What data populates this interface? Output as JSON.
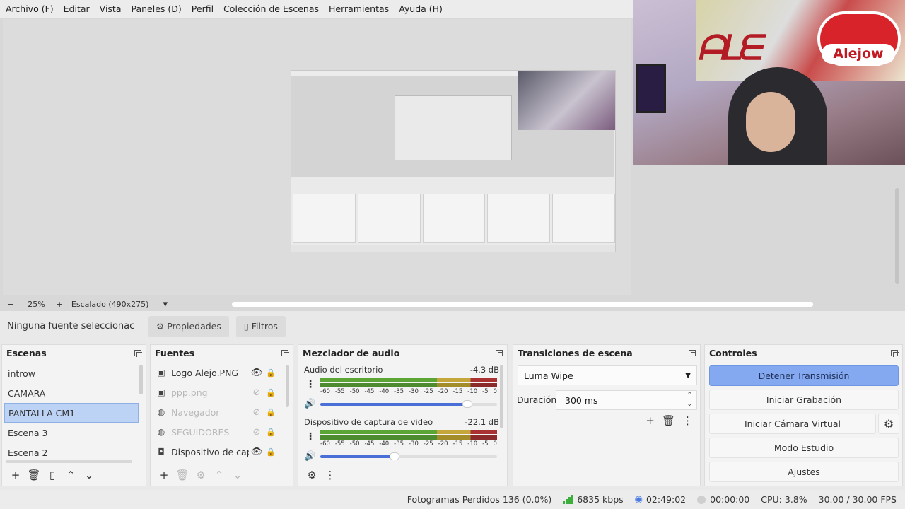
{
  "menu": [
    "Archivo (F)",
    "Editar",
    "Vista",
    "Paneles (D)",
    "Perfil",
    "Colección de Escenas",
    "Herramientas",
    "Ayuda (H)"
  ],
  "webcam": {
    "badge": "Alejow"
  },
  "zoom": {
    "minus": "−",
    "level": "25%",
    "plus": "+",
    "scaling": "Escalado (490x275)",
    "dropdown": "▾"
  },
  "source_toolbar": {
    "no_source": "Ninguna fuente seleccionac",
    "properties": "Propiedades",
    "filters": "Filtros"
  },
  "scenes": {
    "title": "Escenas",
    "items": [
      "introw",
      "CAMARA",
      "PANTALLA CM1",
      "Escena 3",
      "Escena 2"
    ],
    "selected": "PANTALLA CM1"
  },
  "sources": {
    "title": "Fuentes",
    "items": [
      {
        "name": "Logo Alejo.PNG",
        "icon": "image-icon",
        "visible": true,
        "locked": false
      },
      {
        "name": "ppp.png",
        "icon": "image-icon",
        "visible": false,
        "locked": false
      },
      {
        "name": "Navegador",
        "icon": "globe-icon",
        "visible": false,
        "locked": true
      },
      {
        "name": "SEGUIDORES",
        "icon": "globe-icon",
        "visible": false,
        "locked": false
      },
      {
        "name": "Dispositivo de captu",
        "icon": "camera-icon",
        "visible": true,
        "locked": false
      }
    ]
  },
  "mixer": {
    "title": "Mezclador de audio",
    "ticks": [
      "-60",
      "-55",
      "-50",
      "-45",
      "-40",
      "-35",
      "-30",
      "-25",
      "-20",
      "-15",
      "-10",
      "-5",
      "0"
    ],
    "tracks": [
      {
        "name": "Audio del escritorio",
        "db": "-4.3 dB",
        "volume": 0.83
      },
      {
        "name": "Dispositivo de captura de video",
        "db": "-22.1 dB",
        "volume": 0.42
      }
    ]
  },
  "transitions": {
    "title": "Transiciones de escena",
    "selected": "Luma Wipe",
    "duration_label": "Duración",
    "duration": "300 ms"
  },
  "controls": {
    "title": "Controles",
    "stop_stream": "Detener Transmisión",
    "start_recording": "Iniciar Grabación",
    "virtual_cam": "Iniciar Cámara Virtual",
    "studio_mode": "Modo Estudio",
    "settings": "Ajustes"
  },
  "status": {
    "dropped": "Fotogramas Perdidos 136 (0.0%)",
    "bitrate": "6835 kbps",
    "live_time": "02:49:02",
    "rec_time": "00:00:00",
    "cpu": "CPU: 3.8%",
    "fps": "30.00 / 30.00 FPS"
  },
  "colors": {
    "accent": "#84a9f1",
    "selected_row": "#bcd3f5",
    "meter_green": "#4c8b2e"
  }
}
